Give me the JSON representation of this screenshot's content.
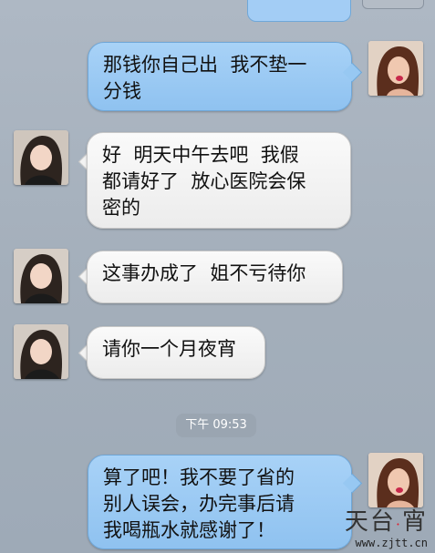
{
  "messages": [
    {
      "side": "out",
      "text": "那钱你自己出  我不垫一\n分钱"
    },
    {
      "side": "in",
      "text": "好  明天中午去吧  我假\n都请好了  放心医院会保\n密的"
    },
    {
      "side": "in",
      "text": "这事办成了  姐不亏待你"
    },
    {
      "side": "in",
      "text": "请你一个月夜宵"
    },
    {
      "side": "out",
      "text": "算了吧！我不要了省的\n别人误会，办完事后请\n我喝瓶水就感谢了！"
    }
  ],
  "timestamp": "下午 09:53",
  "watermark": {
    "title_a": "天",
    "title_b": "台",
    "title_c": "·",
    "title_d": "宵",
    "url": "www.zjtt.cn"
  },
  "colors": {
    "outgoing_bubble": "#96c6f1",
    "incoming_bubble": "#f3f3f3",
    "background": "#a9b4c0"
  }
}
